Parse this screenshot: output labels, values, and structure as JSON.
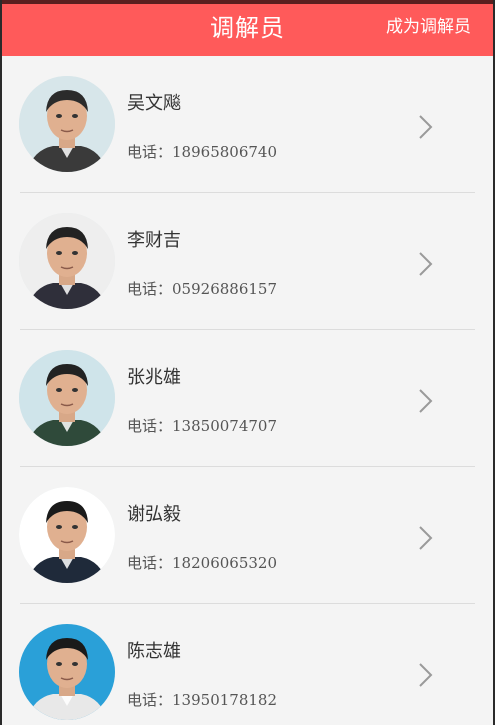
{
  "header": {
    "title": "调解员",
    "action_label": "成为调解员"
  },
  "phone_label": "电话：",
  "mediators": [
    {
      "name": "吴文飚",
      "phone": "18965806740",
      "bg": "#d7e6ea",
      "shirt": "#3a3a3a",
      "hair": "#2b2b2b"
    },
    {
      "name": "李财吉",
      "phone": "05926886157",
      "bg": "#eeeeee",
      "shirt": "#2f2f3a",
      "hair": "#222222"
    },
    {
      "name": "张兆雄",
      "phone": "13850074707",
      "bg": "#cfe4ea",
      "shirt": "#2f4a3a",
      "hair": "#222222"
    },
    {
      "name": "谢弘毅",
      "phone": "18206065320",
      "bg": "#ffffff",
      "shirt": "#1f2a3a",
      "hair": "#1a1a1a"
    },
    {
      "name": "陈志雄",
      "phone": "13950178182",
      "bg": "#2aa0d8",
      "shirt": "#e8e8e8",
      "hair": "#1a1a1a"
    }
  ]
}
